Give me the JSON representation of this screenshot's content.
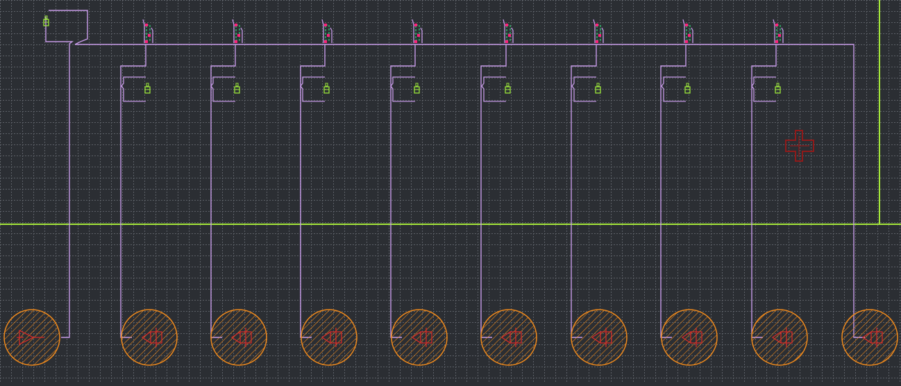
{
  "canvas": {
    "background": "#2b2e33",
    "grid": {
      "visible": true,
      "color": "#6c7078"
    }
  },
  "colors": {
    "board_edge": "#a4e63a",
    "wire": "#c79be8",
    "connector": "#f08a1c",
    "connector_marking": "#d42a2a",
    "terminal": "#ff1f7a",
    "spring": "#2fb46a",
    "component": "#9be83a",
    "crosshair": "#8f1a1a"
  },
  "symbols": {
    "connector": "round-connector-icon",
    "lamp_socket": "lamp-socket-icon",
    "fuse": "fuse-block-icon",
    "crosshair": "crosshair-icon"
  },
  "circuit": {
    "channel_count": 8,
    "connector_count": 10,
    "components": [
      "supply",
      "ch1",
      "ch2",
      "ch3",
      "ch4",
      "ch5",
      "ch6",
      "ch7",
      "ch8"
    ]
  }
}
